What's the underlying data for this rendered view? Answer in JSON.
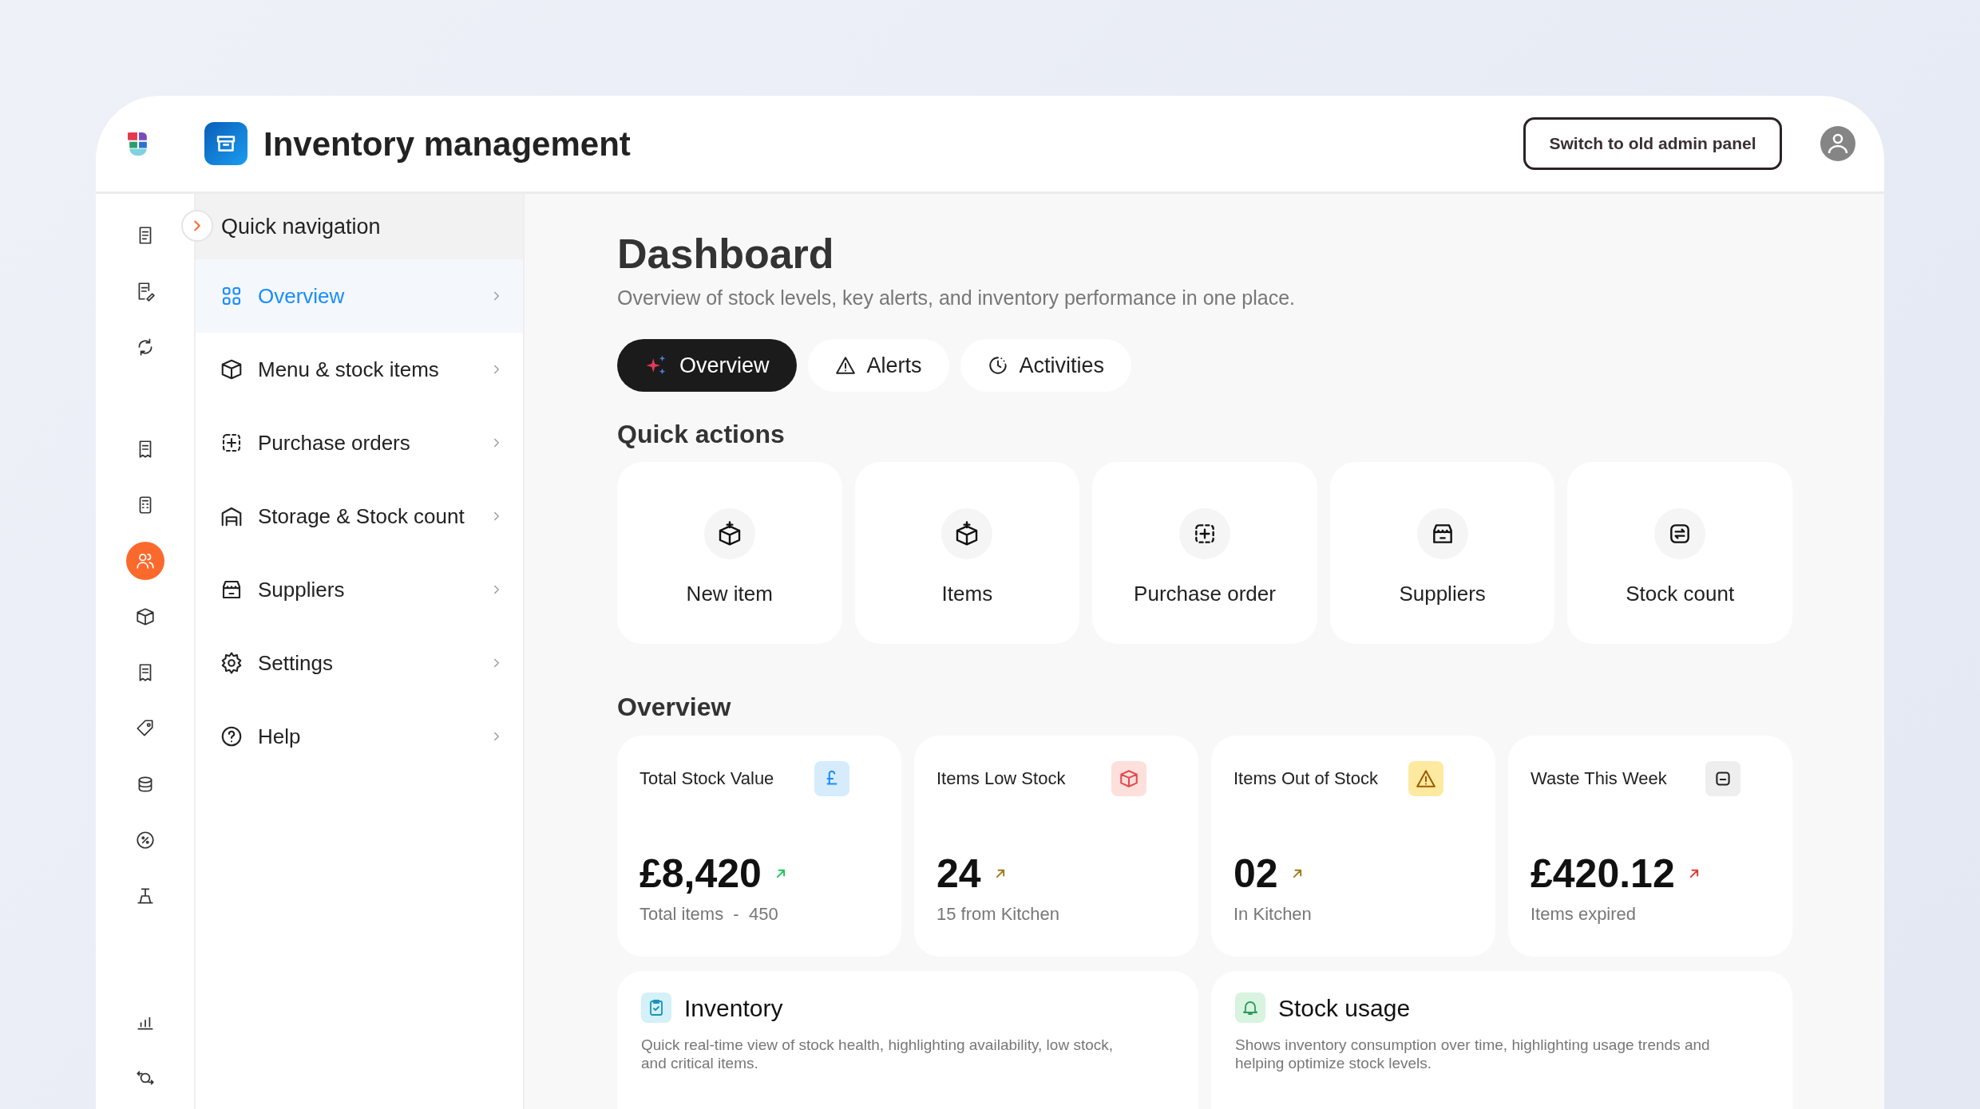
{
  "header": {
    "title": "Inventory management",
    "button": "Switch to old admin panel"
  },
  "rail": {
    "groups": [
      {
        "items": [
          {
            "selected": false
          },
          {
            "selected": false
          },
          {
            "selected": false
          }
        ]
      },
      {
        "items": [
          {
            "selected": false
          },
          {
            "selected": false
          },
          {
            "selected": true
          },
          {
            "selected": false
          },
          {
            "selected": false
          },
          {
            "selected": false
          },
          {
            "selected": false
          },
          {
            "selected": false
          },
          {
            "selected": false
          }
        ]
      },
      {
        "items": [
          {
            "selected": false
          },
          {
            "selected": false
          }
        ]
      }
    ]
  },
  "quick_nav": {
    "title": "Quick navigation",
    "items": [
      {
        "label": "Overview",
        "selected": true
      },
      {
        "label": "Menu & stock items",
        "selected": false
      },
      {
        "label": "Purchase orders",
        "selected": false
      },
      {
        "label": "Storage & Stock count",
        "selected": false
      },
      {
        "label": "Suppliers",
        "selected": false
      },
      {
        "label": "Settings",
        "selected": false
      },
      {
        "label": "Help",
        "selected": false
      }
    ]
  },
  "page": {
    "title": "Dashboard",
    "subtitle": "Overview of stock levels, key alerts, and inventory performance in one place.",
    "tabs": [
      {
        "label": "Overview",
        "kind": "sparkle",
        "selected": true
      },
      {
        "label": "Alerts",
        "kind": "alert",
        "selected": false
      },
      {
        "label": "Activities",
        "kind": "activity",
        "selected": false
      }
    ],
    "quick_actions": {
      "heading": "Quick actions",
      "items": [
        {
          "label": "New item",
          "kind": "boxplus"
        },
        {
          "label": "Items",
          "kind": "boxplus"
        },
        {
          "label": "Purchase order",
          "kind": "dashplus"
        },
        {
          "label": "Suppliers",
          "kind": "store"
        },
        {
          "label": "Stock count",
          "kind": "exchange"
        }
      ]
    },
    "overview": {
      "heading": "Overview",
      "stats": [
        {
          "title": "Total Stock Value",
          "kind": "pound",
          "value": "£8,420",
          "note": "Total items  -  450",
          "color": "#22c55e"
        },
        {
          "title": "Items Low Stock",
          "kind": "box",
          "value": "24",
          "note": "15 from Kitchen",
          "color": "#a07a1e"
        },
        {
          "title": "Items Out of Stock",
          "kind": "warning",
          "value": "02",
          "note": "In Kitchen",
          "color": "#a07a1e"
        },
        {
          "title": "Waste This Week",
          "kind": "bin",
          "value": "£420.12",
          "note": "Items expired",
          "color": "#e53935"
        }
      ]
    },
    "panels": [
      {
        "title": "Inventory",
        "kind": "clipboard",
        "description": "Quick real-time view of stock health, highlighting availability, low stock, and critical items."
      },
      {
        "title": "Stock usage",
        "kind": "bell",
        "description": "Shows inventory consumption over time, highlighting usage trends and helping optimize stock levels."
      }
    ]
  }
}
